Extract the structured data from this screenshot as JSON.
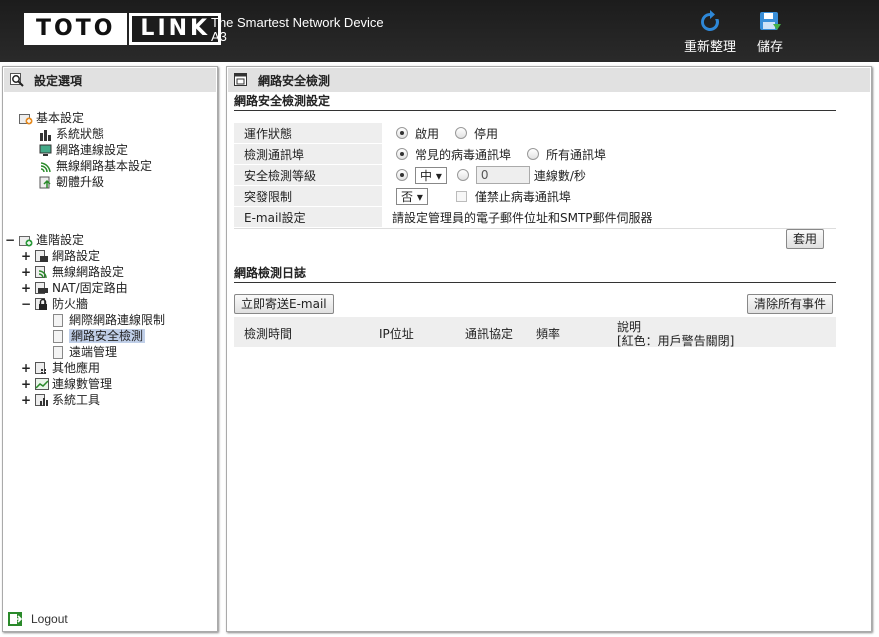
{
  "header": {
    "logo_left": "TOTO",
    "logo_right": "LINK",
    "tagline_line1": "The Smartest Network Device",
    "tagline_line2": "A3",
    "reboot_label": "重新整理",
    "save_label": "儲存"
  },
  "sidebar": {
    "title": "設定選項",
    "basic": {
      "label": "基本設定",
      "items": [
        "系統狀態",
        "網路連線設定",
        "無線網路基本設定",
        "韌體升級"
      ]
    },
    "advanced": {
      "label": "進階設定",
      "items": [
        "網路設定",
        "無線網路設定",
        "NAT/固定路由",
        "防火牆"
      ],
      "firewall_items": [
        "網際網路連線限制",
        "網路安全檢測",
        "遠端管理"
      ],
      "more_items": [
        "其他應用",
        "連線數管理",
        "系統工具"
      ]
    },
    "logout": "Logout"
  },
  "main": {
    "title": "網路安全檢測",
    "settings_title": "網路安全檢測設定",
    "rows": {
      "status": {
        "label": "運作狀態",
        "opt1": "啟用",
        "opt2": "停用"
      },
      "ports": {
        "label": "檢測通訊埠",
        "opt1": "常見的病毒通訊埠",
        "opt2": "所有通訊埠"
      },
      "level": {
        "label": "安全檢測等級",
        "select": "中 ▾",
        "input": "0",
        "unit": "連線數/秒"
      },
      "burst": {
        "label": "突發限制",
        "select": "否 ▾",
        "check": "僅禁止病毒通訊埠"
      },
      "email": {
        "label": "E-mail設定",
        "value": "請設定管理員的電子郵件位址和SMTP郵件伺服器"
      }
    },
    "apply_label": "套用",
    "log_title": "網路檢測日誌",
    "send_email_label": "立即寄送E-mail",
    "clear_label": "清除所有事件",
    "columns": {
      "time": "檢測時間",
      "ip": "IP位址",
      "proto": "通訊協定",
      "freq": "頻率",
      "desc1": "說明",
      "desc2": "[紅色：用戶警告關閉]"
    }
  }
}
